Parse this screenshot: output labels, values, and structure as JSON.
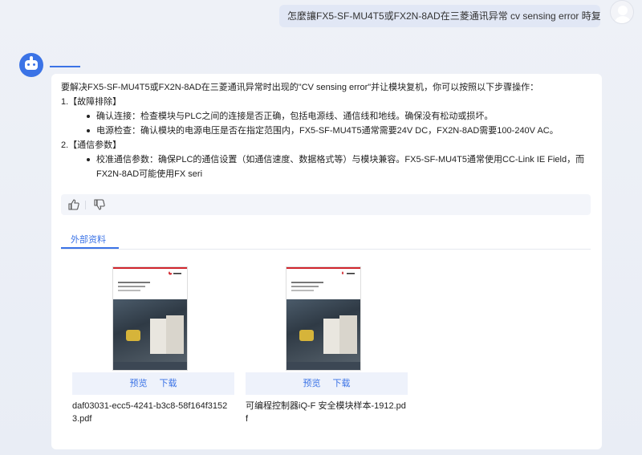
{
  "user_message": "怎麼讓FX5-SF-MU4T5或FX2N-8AD在三菱通讯异常 cv sensing error 時复机?",
  "answer": {
    "intro": "要解决FX5-SF-MU4T5或FX2N-8AD在三菱通讯异常时出现的\"CV sensing error\"并让模块复机，你可以按照以下步骤操作：",
    "section1_title": "1.【故障排除】",
    "section1_items": [
      "确认连接：检查模块与PLC之间的连接是否正确，包括电源线、通信线和地线。确保没有松动或损坏。",
      "电源检查：确认模块的电源电压是否在指定范围内，FX5-SF-MU4T5通常需要24V DC，FX2N-8AD需要100-240V AC。"
    ],
    "section2_title": "2.【通信参数】",
    "section2_item_line1": "校准通信参数：确保PLC的通信设置（如通信速度、数据格式等）与模块兼容。FX5-SF-MU4T5通常使用CC-Link IE Field，而",
    "section2_item_line2": "FX2N-8AD可能使用FX seri"
  },
  "feedback": {
    "like_icon": "thumbs-up-icon",
    "dislike_icon": "thumbs-down-icon"
  },
  "tabs": {
    "external": "外部资料"
  },
  "documents": [
    {
      "preview_label": "预览",
      "download_label": "下载",
      "filename": "daf03031-ecc5-4241-b3c8-58f164f31523.pdf"
    },
    {
      "preview_label": "预览",
      "download_label": "下载",
      "filename": "可编程控制器iQ-F 安全模块样本-1912.pdf"
    }
  ],
  "colors": {
    "accent": "#3b73e6",
    "bubble": "#e1e7f5"
  }
}
